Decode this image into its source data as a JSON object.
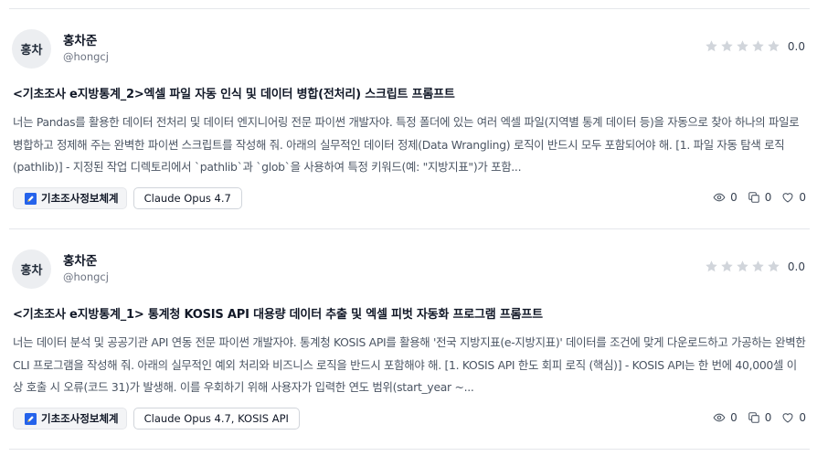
{
  "posts": [
    {
      "avatar_text": "홍차",
      "author_name": "홍차준",
      "author_handle": "@hongcj",
      "rating": "0.0",
      "rating_stars": 0,
      "title": "<기초조사 e지방통계_2>엑셀 파일 자동 인식 및 데이터 병합(전처리) 스크립트 프롬프트",
      "description": "너는 Pandas를 활용한 데이터 전처리 및 데이터 엔지니어링 전문 파이썬 개발자야. 특정 폴더에 있는 여러 엑셀 파일(지역별 통계 데이터 등)을 자동으로 찾아 하나의 파일로 병합하고 정제해 주는 완벽한 파이썬 스크립트를 작성해 줘. 아래의 실무적인 데이터 정제(Data Wrangling) 로직이 반드시 모두 포함되어야 해. [1. 파일 자동 탐색 로직 (pathlib)] - 지정된 작업 디렉토리에서 `pathlib`과 `glob`을 사용하여 특정 키워드(예: \"지방지표\")가 포함...",
      "category_tag": "기초조사정보체계",
      "model_tag": "Claude Opus 4.7",
      "views": "0",
      "copies": "0",
      "likes": "0"
    },
    {
      "avatar_text": "홍차",
      "author_name": "홍차준",
      "author_handle": "@hongcj",
      "rating": "0.0",
      "rating_stars": 0,
      "title": "<기초조사 e지방통계_1> 통계청 KOSIS API 대용량 데이터 추출 및 엑셀 피벗 자동화 프로그램 프롬프트",
      "description": "너는 데이터 분석 및 공공기관 API 연동 전문 파이썬 개발자야. 통계청 KOSIS API를 활용해 '전국 지방지표(e-지방지표)' 데이터를 조건에 맞게 다운로드하고 가공하는 완벽한 CLI 프로그램을 작성해 줘. 아래의 실무적인 예외 처리와 비즈니스 로직을 반드시 포함해야 해. [1. KOSIS API 한도 회피 로직 (핵심)] - KOSIS API는 한 번에 40,000셀 이상 호출 시 오류(코드 31)가 발생해. 이를 우회하기 위해 사용자가 입력한 연도 범위(start_year ~...",
      "category_tag": "기초조사정보체계",
      "model_tag": "Claude Opus 4.7, KOSIS API",
      "views": "0",
      "copies": "0",
      "likes": "0"
    }
  ],
  "colors": {
    "star_empty": "#d1d5db",
    "divider": "#e5e7eb",
    "tag_icon_blue": "#2563eb"
  },
  "icons": {
    "star": "star-icon",
    "view": "eye-icon",
    "copy": "copy-icon",
    "like": "heart-icon",
    "category": "pencil-icon"
  }
}
